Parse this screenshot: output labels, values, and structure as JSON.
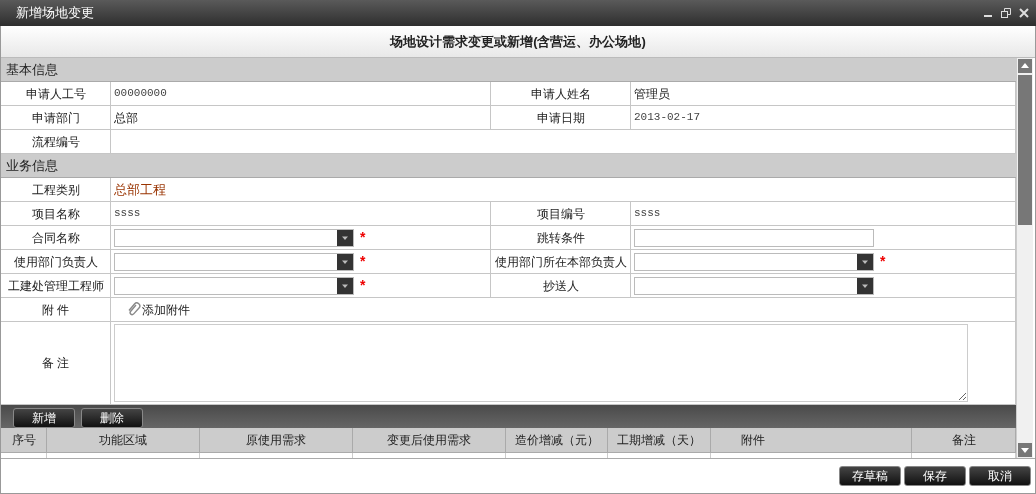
{
  "window": {
    "title": "新增场地变更"
  },
  "form_title": "场地设计需求变更或新增(含营运、办公场地)",
  "sections": [
    {
      "title": "基本信息",
      "rows": [
        [
          {
            "label": "申请人工号",
            "kind": "mono",
            "value": "00000000"
          },
          {
            "label": "申请人姓名",
            "kind": "text",
            "value": "管理员"
          }
        ],
        [
          {
            "label": "申请部门",
            "kind": "text",
            "value": "总部"
          },
          {
            "label": "申请日期",
            "kind": "mono",
            "value": "2013-02-17"
          }
        ],
        [
          {
            "label": "流程编号",
            "kind": "text"
          }
        ]
      ]
    },
    {
      "title": "业务信息",
      "rows": [
        [
          {
            "label": "工程类别",
            "kind": "category",
            "value": "总部工程"
          }
        ],
        [
          {
            "label": "项目名称",
            "kind": "mono",
            "value": "ssss"
          },
          {
            "label": "项目编号",
            "kind": "mono",
            "value": "ssss"
          }
        ],
        [
          {
            "label": "合同名称",
            "kind": "select",
            "required_mark": "*"
          },
          {
            "label": "跳转条件",
            "kind": "input"
          }
        ],
        [
          {
            "label": "使用部门负责人",
            "kind": "select",
            "required_mark": "*"
          },
          {
            "label": "使用部门所在本部负责人",
            "kind": "select",
            "required_mark": "*"
          }
        ],
        [
          {
            "label": "工建处管理工程师",
            "kind": "select",
            "required_mark": "*"
          },
          {
            "label": "抄送人",
            "kind": "select"
          }
        ],
        [
          {
            "label": "附 件",
            "kind": "attachment",
            "value": "添加附件"
          }
        ],
        [
          {
            "label": "备 注",
            "kind": "textarea"
          }
        ]
      ]
    }
  ],
  "table": {
    "toolbar": [
      "新增",
      "删除"
    ],
    "columns": [
      "序号",
      "功能区域",
      "原使用需求",
      "变更后使用需求",
      "造价增减（元）",
      "工期增减（天）",
      "附件",
      "备注"
    ]
  },
  "footer_buttons": [
    "存草稿",
    "保存",
    "取消"
  ]
}
